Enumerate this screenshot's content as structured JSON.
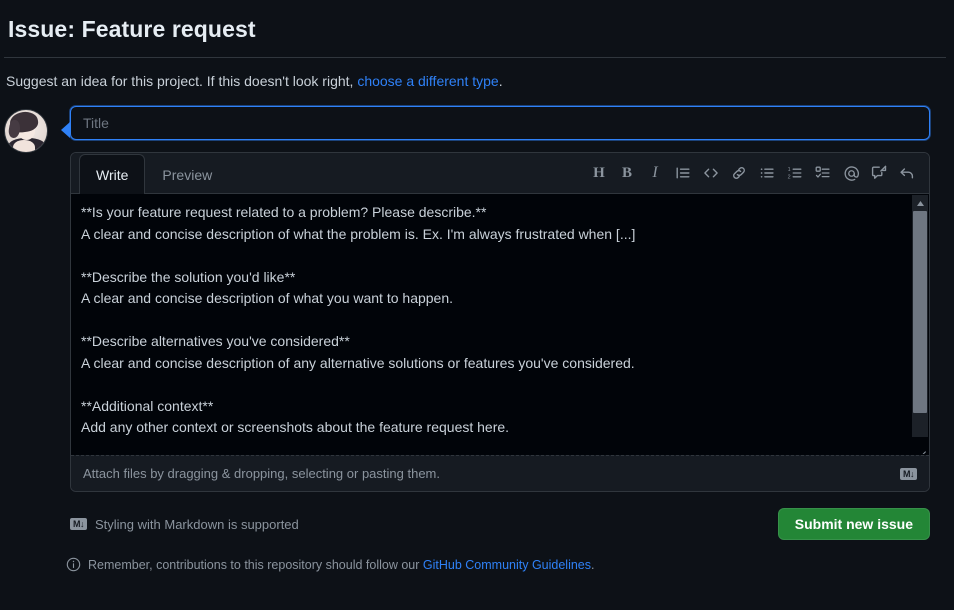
{
  "header": {
    "title": "Issue: Feature request",
    "subtitle_prefix": "Suggest an idea for this project. If this doesn't look right, ",
    "subtitle_link": "choose a different type",
    "subtitle_suffix": "."
  },
  "composer": {
    "title_placeholder": "Title",
    "title_value": "",
    "tabs": [
      {
        "label": "Write",
        "active": true
      },
      {
        "label": "Preview",
        "active": false
      }
    ],
    "toolbar": [
      {
        "name": "heading-icon",
        "label": "H",
        "title": "Add heading text"
      },
      {
        "name": "bold-icon",
        "label": "B",
        "title": "Add bold text"
      },
      {
        "name": "italic-icon",
        "label": "I",
        "title": "Add italic text"
      },
      {
        "name": "quote-icon",
        "label": "",
        "title": "Add a quote"
      },
      {
        "name": "code-icon",
        "label": "<>",
        "title": "Add code"
      },
      {
        "name": "link-icon",
        "label": "",
        "title": "Add a link"
      },
      {
        "name": "unordered-list-icon",
        "label": "",
        "title": "Add a bulleted list"
      },
      {
        "name": "ordered-list-icon",
        "label": "",
        "title": "Add a numbered list"
      },
      {
        "name": "task-list-icon",
        "label": "",
        "title": "Add a task list"
      },
      {
        "name": "mention-icon",
        "label": "@",
        "title": "Directly mention a user or team"
      },
      {
        "name": "saved-reply-icon",
        "label": "",
        "title": "Add saved reply"
      },
      {
        "name": "reference-icon",
        "label": "",
        "title": "Reference an issue or pull request"
      }
    ],
    "body_text": "**Is your feature request related to a problem? Please describe.**\nA clear and concise description of what the problem is. Ex. I'm always frustrated when [...]\n\n**Describe the solution you'd like**\nA clear and concise description of what you want to happen.\n\n**Describe alternatives you've considered**\nA clear and concise description of any alternative solutions or features you've considered.\n\n**Additional context**\nAdd any other context or screenshots about the feature request here.",
    "attach_text": "Attach files by dragging & dropping, selecting or pasting them.",
    "attach_badge": "M↓"
  },
  "actions": {
    "markdown_badge": "M↓",
    "markdown_support": "Styling with Markdown is supported",
    "submit_label": "Submit new issue"
  },
  "footer": {
    "text_prefix": "Remember, contributions to this repository should follow our ",
    "link": "GitHub Community Guidelines",
    "text_suffix": "."
  },
  "colors": {
    "background": "#0d1117",
    "surface": "#161b22",
    "textarea_bg": "#010409",
    "border": "#30363d",
    "accent_link": "#2f81f7",
    "submit_green": "#238636",
    "text_primary": "#e6edf3",
    "text_muted": "#8b949e"
  }
}
